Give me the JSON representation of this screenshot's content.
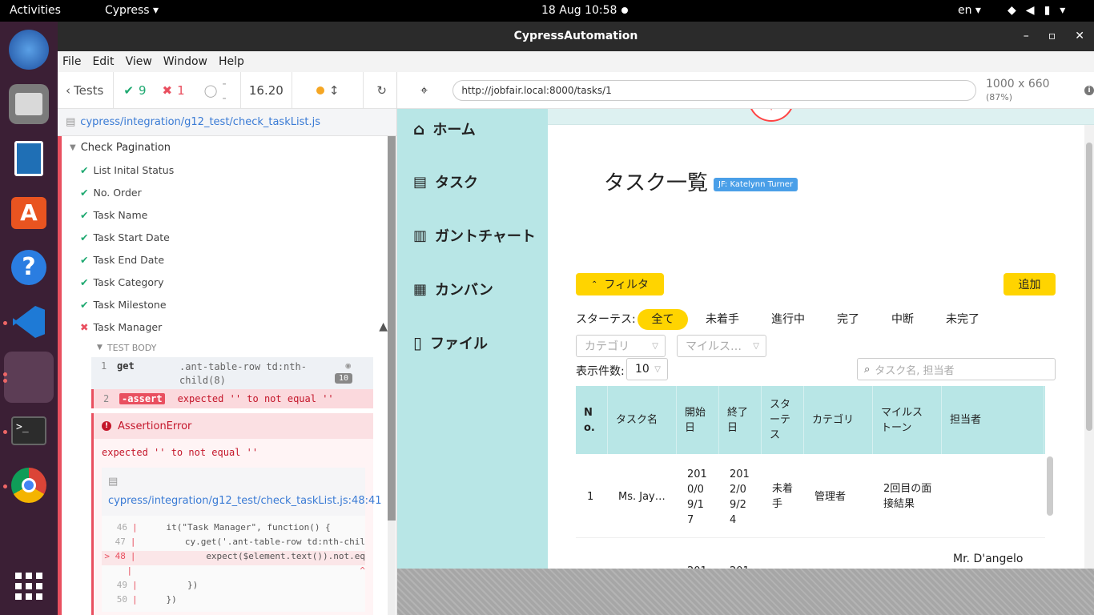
{
  "topbar": {
    "activities": "Activities",
    "app_name": "Cypress ▾",
    "clock": "18 Aug  10:58",
    "lang": "en ▾"
  },
  "window": {
    "title": "CypressAutomation",
    "menu": [
      "File",
      "Edit",
      "View",
      "Window",
      "Help"
    ]
  },
  "reporter": {
    "tests_label": "Tests",
    "passed": "9",
    "failed": "1",
    "pending": "--",
    "duration": "16.20",
    "spec_path": "cypress/integration/g12_test/check_taskList.js",
    "suite": "Check Pagination",
    "tests": [
      {
        "title": "List Inital Status",
        "state": "passed"
      },
      {
        "title": "No. Order",
        "state": "passed"
      },
      {
        "title": "Task Name",
        "state": "passed"
      },
      {
        "title": "Task Start Date",
        "state": "passed"
      },
      {
        "title": "Task End Date",
        "state": "passed"
      },
      {
        "title": "Task Category",
        "state": "passed"
      },
      {
        "title": "Task Milestone",
        "state": "passed"
      },
      {
        "title": "Task Manager",
        "state": "failed"
      }
    ],
    "test_body_label": "TEST BODY",
    "commands": [
      {
        "num": "1",
        "name": "get",
        "message": ".ant-table-row td:nth-child(8)",
        "badge": "10"
      },
      {
        "num": "2",
        "name": "-assert",
        "message": "expected  ''  to not equal  ''"
      }
    ],
    "error": {
      "name": "AssertionError",
      "message": "expected '' to not equal ''",
      "file": "cypress/integration/g12_test/check_taskList.js:48:41",
      "code": [
        {
          "ln": "46",
          "text": "    it(\"Task Manager\", function() {"
        },
        {
          "ln": "47",
          "text": "        cy.get('.ant-table-row td:nth-chil"
        },
        {
          "ln": "> 48",
          "text": "            expect($element.text()).not.eq"
        },
        {
          "ln": "",
          "text": "                                          ^"
        },
        {
          "ln": "49",
          "text": "        })"
        },
        {
          "ln": "50",
          "text": "    })"
        }
      ]
    }
  },
  "aut": {
    "url": "http://jobfair.local:8000/tasks/1",
    "viewport": "1000 x 660",
    "scale": "(87%)"
  },
  "app": {
    "sidebar": [
      "ホーム",
      "タスク",
      "ガントチャート",
      "カンバン",
      "ファイル"
    ],
    "page_title": "タスク一覧",
    "jf_badge": "JF: Katelynn Turner",
    "filter_button": "フィルタ",
    "add_button": "追加",
    "status_label": "スターテス:",
    "status_tabs": [
      "全て",
      "未着手",
      "進行中",
      "完了",
      "中断",
      "未完了"
    ],
    "category_placeholder": "カテゴリ",
    "milestone_placeholder": "マイルス…",
    "per_page_label": "表示件数:",
    "per_page_value": "10",
    "search_placeholder": "タスク名, 担当者",
    "table": {
      "headers": [
        "N\no.",
        "タスク名",
        "開始\n日",
        "終了\n日",
        "スタ\nーテ\nス",
        "カテゴリ",
        "マイルス\nトーン",
        "担当者"
      ],
      "rows": [
        [
          "1",
          "Ms. Jay…",
          "201\n0/0\n9/1\n7",
          "201\n2/0\n9/2\n4",
          "未着\n手",
          "管理者",
          "2回目の面\n接結果",
          ""
        ],
        [
          "",
          "",
          "201",
          "201",
          "",
          "",
          "",
          "Mr. D'angelo\nReilly, Looper"
        ]
      ]
    }
  }
}
